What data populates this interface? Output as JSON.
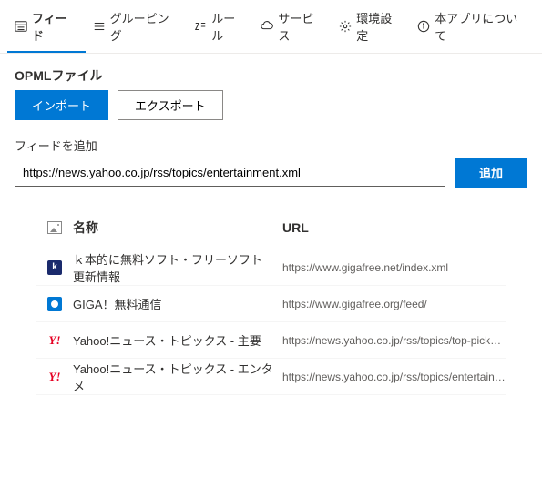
{
  "tabs": [
    {
      "label": "フィード",
      "active": true,
      "icon": "feed"
    },
    {
      "label": "グルーピング",
      "active": false,
      "icon": "group"
    },
    {
      "label": "ルール",
      "active": false,
      "icon": "rule"
    },
    {
      "label": "サービス",
      "active": false,
      "icon": "service"
    },
    {
      "label": "環境設定",
      "active": false,
      "icon": "settings"
    },
    {
      "label": "本アプリについて",
      "active": false,
      "icon": "about"
    }
  ],
  "opml": {
    "title": "OPMLファイル",
    "import_label": "インポート",
    "export_label": "エクスポート"
  },
  "add": {
    "title": "フィードを追加",
    "value": "https://news.yahoo.co.jp/rss/topics/entertainment.xml",
    "button": "追加"
  },
  "table": {
    "headers": {
      "name": "名称",
      "url": "URL"
    },
    "rows": [
      {
        "icon": "k",
        "name": "ｋ本的に無料ソフト・フリーソフト 更新情報",
        "url": "https://www.gigafree.net/index.xml"
      },
      {
        "icon": "giga",
        "name": "GIGA！無料通信",
        "url": "https://www.gigafree.org/feed/"
      },
      {
        "icon": "y",
        "name": "Yahoo!ニュース・トピックス - 主要",
        "url": "https://news.yahoo.co.jp/rss/topics/top-picks.xml"
      },
      {
        "icon": "y",
        "name": "Yahoo!ニュース・トピックス - エンタメ",
        "url": "https://news.yahoo.co.jp/rss/topics/entertainment...."
      }
    ]
  }
}
